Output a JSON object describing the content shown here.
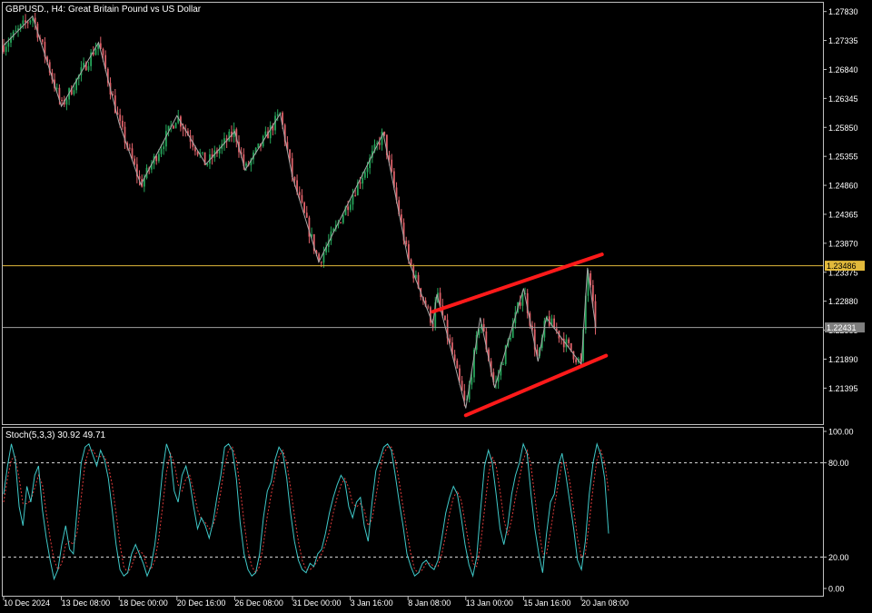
{
  "header": {
    "symbol": "GBPUSD.",
    "timeframe": "H4",
    "description": "Great Britain Pound vs US Dollar"
  },
  "colors": {
    "background": "#000000",
    "frame": "#bfbfbf",
    "bull": "#26a65b",
    "bear": "#e0626a",
    "zigzag": "#a8a8a8",
    "horizontal_line": "#e2b93b",
    "bid_line": "#a0a0a0",
    "channel": "#ff1a1a",
    "stoch_main": "#3fc8c8",
    "stoch_signal": "#e03a3a",
    "stoch_level": "#d9d9d9"
  },
  "chart_data": [
    {
      "type": "candlestick",
      "title": "GBPUSD., H4:  Great Britain Pound vs US Dollar",
      "y_ticks": [
        "1.27830",
        "1.27335",
        "1.26840",
        "1.26345",
        "1.25850",
        "1.25355",
        "1.24860",
        "1.24365",
        "1.23870",
        "1.23375",
        "1.22880",
        "1.22385",
        "1.21890",
        "1.21395"
      ],
      "ylim": [
        1.2078,
        1.2798
      ],
      "x_ticks": [
        "10 Dec 2024",
        "13 Dec 08:00",
        "18 Dec 00:00",
        "20 Dec 16:00",
        "26 Dec 08:00",
        "31 Dec 00:00",
        "3 Jan 16:00",
        "8 Jan 08:00",
        "13 Jan 00:00",
        "15 Jan 16:00",
        "20 Jan 08:00"
      ],
      "horizontal_level": {
        "value": 1.23486,
        "label": "1.23486"
      },
      "bid_price": {
        "value": 1.22431,
        "label": "1.22431"
      },
      "zigzag": [
        {
          "x": "10 Dec 2024",
          "y": 1.2725
        },
        {
          "x": "11 Dec 16:00",
          "y": 1.2775
        },
        {
          "x": "13 Dec 08:00",
          "y": 1.2621
        },
        {
          "x": "16 Dec 08:00",
          "y": 1.273
        },
        {
          "x": "18 Dec 00:00",
          "y": 1.2592
        },
        {
          "x": "19 Dec 00:00",
          "y": 1.2487
        },
        {
          "x": "20 Dec 16:00",
          "y": 1.2605
        },
        {
          "x": "23 Dec 12:00",
          "y": 1.2522
        },
        {
          "x": "26 Dec 08:00",
          "y": 1.2578
        },
        {
          "x": "27 Dec 04:00",
          "y": 1.2512
        },
        {
          "x": "30 Dec 00:00",
          "y": 1.2608
        },
        {
          "x": "31 Dec 00:00",
          "y": 1.25
        },
        {
          "x": "1 Jan 16:00",
          "y": 1.2355
        },
        {
          "x": "6 Jan 08:00",
          "y": 1.2575
        },
        {
          "x": "8 Jan 08:00",
          "y": 1.236
        },
        {
          "x": "10 Jan 08:00",
          "y": 1.2249
        },
        {
          "x": "10 Jan 16:00",
          "y": 1.23
        },
        {
          "x": "13 Jan 00:00",
          "y": 1.2105
        },
        {
          "x": "13 Jan 16:00",
          "y": 1.226
        },
        {
          "x": "14 Jan 08:00",
          "y": 1.214
        },
        {
          "x": "15 Jan 16:00",
          "y": 1.231
        },
        {
          "x": "16 Jan 20:00",
          "y": 1.2185
        },
        {
          "x": "17 Jan 12:00",
          "y": 1.226
        },
        {
          "x": "20 Jan 08:00",
          "y": 1.218
        },
        {
          "x": "20 Jan 20:00",
          "y": 1.2345
        },
        {
          "x": "21 Jan 12:00",
          "y": 1.2243
        }
      ],
      "channel_lines": [
        {
          "from": {
            "x": "10 Jan 08:00",
            "y": 1.227
          },
          "to": {
            "x": "22 Jan 00:00",
            "y": 1.2368
          }
        },
        {
          "from": {
            "x": "13 Jan 00:00",
            "y": 1.2093
          },
          "to": {
            "x": "22 Jan 08:00",
            "y": 1.2195
          }
        }
      ]
    },
    {
      "type": "line",
      "title": "Stoch(5,3,3) 30.92 49.71",
      "indicator": "Stoch(5,3,3)",
      "values_text": "30.92 49.71",
      "main_value": 30.92,
      "signal_value": 49.71,
      "ylim": [
        0,
        100
      ],
      "y_ticks": [
        "100.00",
        "80.00",
        "20.00",
        "0.00"
      ],
      "levels": [
        80,
        20
      ],
      "series": [
        {
          "name": "Main",
          "values": [
            60,
            78,
            92,
            82,
            52,
            40,
            65,
            55,
            72,
            78,
            50,
            32,
            18,
            6,
            12,
            28,
            40,
            25,
            22,
            52,
            80,
            90,
            92,
            85,
            78,
            88,
            82,
            70,
            50,
            28,
            12,
            8,
            10,
            22,
            28,
            22,
            16,
            8,
            14,
            28,
            50,
            75,
            92,
            85,
            62,
            55,
            72,
            78,
            68,
            52,
            38,
            45,
            40,
            32,
            42,
            58,
            72,
            90,
            92,
            88,
            70,
            42,
            22,
            12,
            8,
            10,
            22,
            45,
            62,
            68,
            82,
            90,
            86,
            70,
            48,
            30,
            18,
            12,
            10,
            16,
            14,
            22,
            25,
            35,
            48,
            58,
            66,
            72,
            68,
            52,
            45,
            55,
            58,
            40,
            30,
            55,
            75,
            82,
            90,
            92,
            88,
            72,
            55,
            40,
            22,
            14,
            8,
            10,
            16,
            18,
            14,
            12,
            18,
            32,
            48,
            58,
            65,
            60,
            45,
            28,
            15,
            8,
            20,
            50,
            78,
            88,
            80,
            60,
            38,
            28,
            40,
            60,
            72,
            80,
            92,
            86,
            60,
            38,
            22,
            10,
            35,
            55,
            60,
            78,
            86,
            72,
            55,
            38,
            18,
            12,
            30,
            60,
            80,
            92,
            85,
            70,
            35
          ]
        },
        {
          "name": "Signal",
          "values": [
            55,
            70,
            82,
            84,
            70,
            54,
            54,
            56,
            64,
            72,
            66,
            48,
            32,
            18,
            12,
            16,
            28,
            30,
            28,
            36,
            58,
            80,
            88,
            88,
            84,
            84,
            84,
            78,
            66,
            48,
            28,
            14,
            10,
            14,
            22,
            24,
            22,
            14,
            12,
            18,
            32,
            52,
            74,
            86,
            80,
            66,
            62,
            70,
            72,
            62,
            50,
            44,
            42,
            38,
            40,
            48,
            62,
            78,
            88,
            90,
            82,
            64,
            42,
            24,
            14,
            10,
            14,
            28,
            46,
            60,
            72,
            84,
            88,
            80,
            64,
            46,
            30,
            18,
            12,
            12,
            14,
            18,
            22,
            28,
            36,
            48,
            58,
            66,
            70,
            64,
            54,
            52,
            54,
            50,
            40,
            44,
            58,
            74,
            86,
            90,
            90,
            82,
            68,
            52,
            36,
            22,
            12,
            10,
            12,
            16,
            16,
            14,
            14,
            22,
            34,
            48,
            58,
            62,
            56,
            42,
            28,
            16,
            14,
            28,
            50,
            72,
            84,
            78,
            62,
            44,
            34,
            44,
            58,
            70,
            82,
            88,
            78,
            58,
            38,
            22,
            22,
            36,
            52,
            66,
            80,
            80,
            68,
            50,
            32,
            20,
            22,
            42,
            64,
            82,
            88,
            80,
            62
          ]
        }
      ]
    }
  ]
}
